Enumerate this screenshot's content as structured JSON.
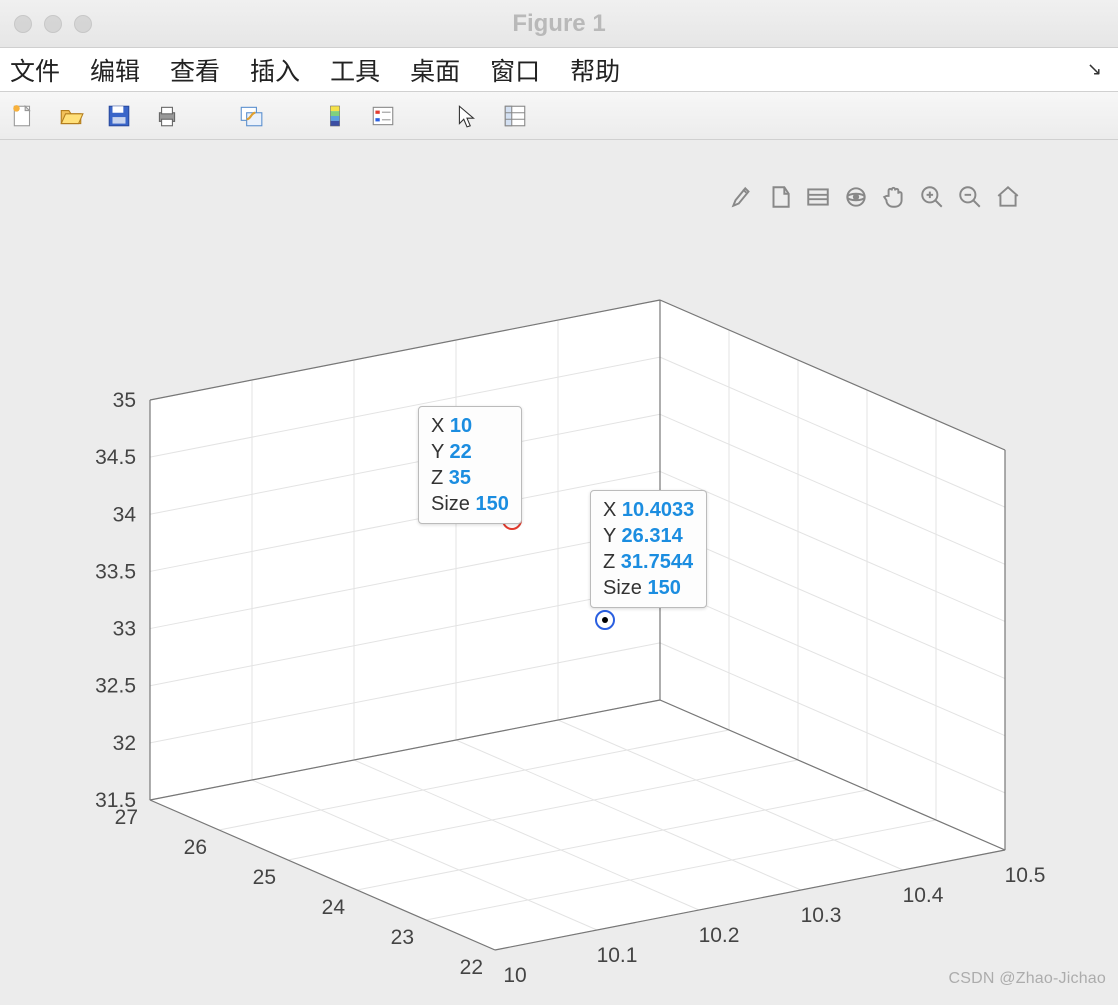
{
  "window": {
    "title": "Figure 1"
  },
  "menu": {
    "file": "文件",
    "edit": "编辑",
    "view": "查看",
    "insert": "插入",
    "tools": "工具",
    "desktop": "桌面",
    "window": "窗口",
    "help": "帮助"
  },
  "toolbar_icons": [
    "new",
    "open",
    "save",
    "print",
    "link",
    "colorbar",
    "legend",
    "cursor",
    "data-cursor"
  ],
  "plot_toolbar_icons": [
    "brush",
    "export",
    "stack",
    "rotate",
    "pan",
    "zoom-in",
    "zoom-out",
    "home"
  ],
  "chart_data": {
    "type": "scatter",
    "title": "",
    "xlabel": "",
    "ylabel": "",
    "zlabel": "",
    "axes": {
      "x": {
        "label": "",
        "lim": [
          10,
          10.5
        ],
        "ticks": [
          10,
          10.1,
          10.2,
          10.3,
          10.4,
          10.5
        ]
      },
      "y": {
        "label": "",
        "lim": [
          22,
          27
        ],
        "ticks": [
          22,
          23,
          24,
          25,
          26,
          27
        ]
      },
      "z": {
        "label": "",
        "lim": [
          31.5,
          35
        ],
        "ticks": [
          31.5,
          32,
          32.5,
          33,
          33.5,
          34,
          34.5,
          35
        ]
      }
    },
    "series": [
      {
        "name": "red",
        "color": "#e23b2e",
        "x": 10,
        "y": 22,
        "z": 35,
        "size": 150
      },
      {
        "name": "blue",
        "color": "#2a5fe0",
        "x": 10.4033,
        "y": 26.314,
        "z": 31.7544,
        "size": 150
      }
    ]
  },
  "datatips": [
    {
      "labels": {
        "x": "X",
        "y": "Y",
        "z": "Z",
        "size": "Size"
      },
      "values": {
        "x": "10",
        "y": "22",
        "z": "35",
        "size": "150"
      }
    },
    {
      "labels": {
        "x": "X",
        "y": "Y",
        "z": "Z",
        "size": "Size"
      },
      "values": {
        "x": "10.4033",
        "y": "26.314",
        "z": "31.7544",
        "size": "150"
      }
    }
  ],
  "watermark": "CSDN @Zhao-Jichao"
}
